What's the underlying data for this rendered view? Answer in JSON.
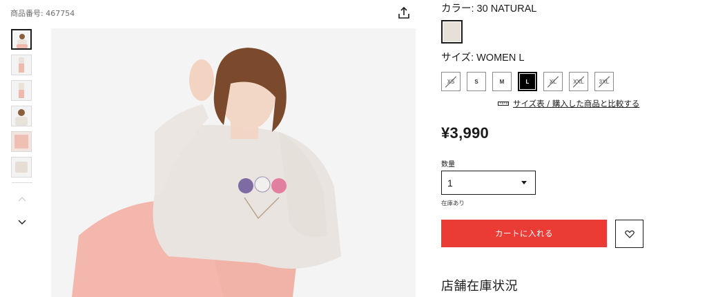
{
  "product": {
    "id_label": "商品番号: 467754"
  },
  "gallery": {
    "thumbnail_count": 6,
    "active_index": 0
  },
  "panel": {
    "color_label": "カラー:  30 NATURAL",
    "swatch_color": "#e6e0d9",
    "size_label": "サイズ:  WOMEN L",
    "sizes": [
      {
        "label": "XS",
        "state": "soldout"
      },
      {
        "label": "S",
        "state": "available"
      },
      {
        "label": "M",
        "state": "available"
      },
      {
        "label": "L",
        "state": "selected"
      },
      {
        "label": "XL",
        "state": "soldout"
      },
      {
        "label": "XXL",
        "state": "soldout"
      },
      {
        "label": "3XL",
        "state": "soldout"
      }
    ],
    "size_compare_link": "サイズ表 / 購入した商品と比較する",
    "price": "¥3,990",
    "quantity_label": "数量",
    "quantity_value": "1",
    "stock_status": "在庫あり",
    "cart_button": "カートに入れる",
    "store_stock_title": "店舗在庫状況"
  },
  "colors": {
    "accent": "#ea3b35",
    "text": "#1b1b1b"
  }
}
